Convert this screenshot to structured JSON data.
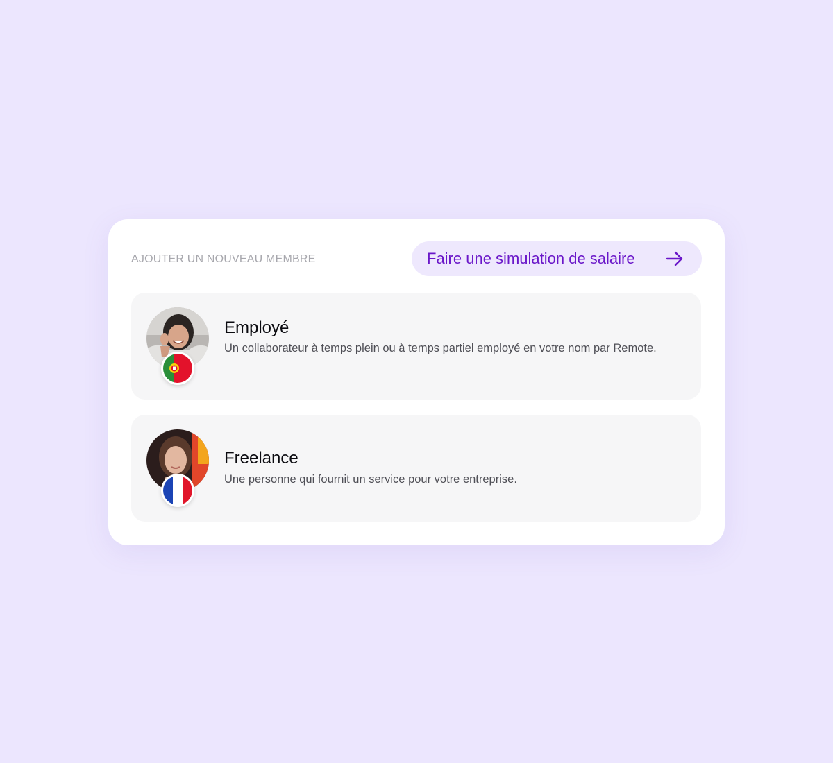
{
  "header": {
    "section_label": "AJOUTER UN NOUVEAU MEMBRE",
    "simulation_button_label": "Faire une simulation de salaire",
    "simulation_button_icon": "arrow-right-icon"
  },
  "options": [
    {
      "title": "Employé",
      "description": "Un collaborateur à temps plein ou à temps partiel employé en votre nom par Remote.",
      "flag": "portugal-flag-icon"
    },
    {
      "title": "Freelance",
      "description": "Une personne qui fournit un service pour votre entreprise.",
      "flag": "france-flag-icon"
    }
  ],
  "colors": {
    "background": "#ece6fe",
    "card": "#ffffff",
    "accent": "#6a17c9",
    "button_bg": "#eee8fd",
    "option_bg": "#f6f6f7"
  }
}
